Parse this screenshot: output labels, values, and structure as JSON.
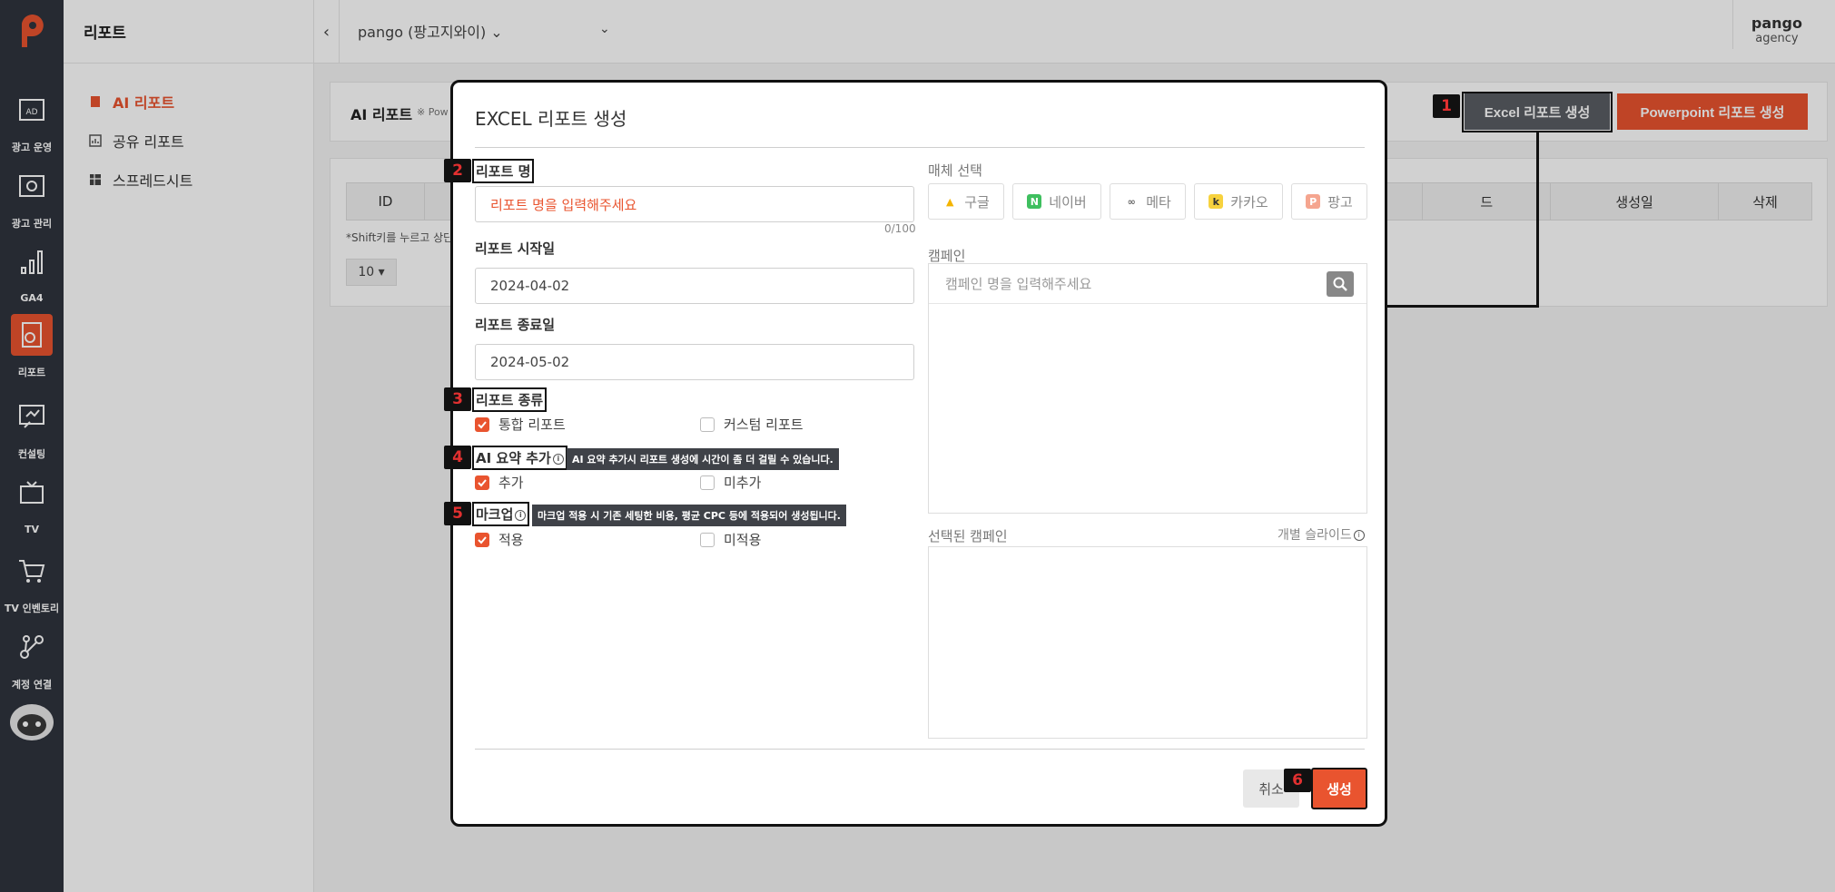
{
  "nav": {
    "items": [
      {
        "label": "광고 운영"
      },
      {
        "label": "광고 관리"
      },
      {
        "label": "GA4"
      },
      {
        "label": "리포트"
      },
      {
        "label": "컨설팅"
      },
      {
        "label": "TV"
      },
      {
        "label": "TV 인벤토리"
      },
      {
        "label": "계정 연결"
      }
    ]
  },
  "sidepanel": {
    "title": "리포트",
    "menu": [
      {
        "label": "AI 리포트"
      },
      {
        "label": "공유 리포트"
      },
      {
        "label": "스프레드시트"
      }
    ]
  },
  "topbar": {
    "account": "pango (팡고지와이) ⌄",
    "user_name": "pango",
    "user_role": "agency"
  },
  "content": {
    "header_title": "AI 리포트",
    "header_note": "※ Pow",
    "excel_button": "Excel 리포트 생성",
    "ppt_button": "Powerpoint 리포트 생성",
    "table_headers": [
      "ID",
      "",
      "드",
      "생성일",
      "삭제"
    ],
    "table_note": "*Shift키를 누르고 상단",
    "page_size": "10 ▾"
  },
  "modal": {
    "title": "EXCEL 리포트 생성",
    "report_name_label": "리포트 명",
    "report_name_placeholder": "리포트 명을 입력해주세요",
    "report_name_counter": "0/100",
    "start_label": "리포트 시작일",
    "start_value": "2024-04-02",
    "end_label": "리포트 종료일",
    "end_value": "2024-05-02",
    "type_label": "리포트 종류",
    "type_options": [
      {
        "label": "통합 리포트",
        "checked": true
      },
      {
        "label": "커스텀 리포트",
        "checked": false
      }
    ],
    "ai_label": "AI 요약 추가",
    "ai_tooltip": "AI 요약 추가시 리포트 생성에 시간이 좀 더 걸릴 수 있습니다.",
    "ai_options": [
      {
        "label": "추가",
        "checked": true
      },
      {
        "label": "미추가",
        "checked": false
      }
    ],
    "markup_label": "마크업",
    "markup_tooltip": "마크업 적용 시 기존 세팅한 비용, 평균 CPC 등에 적용되어 생성됩니다.",
    "markup_options": [
      {
        "label": "적용",
        "checked": true
      },
      {
        "label": "미적용",
        "checked": false
      }
    ],
    "media_label": "매체 선택",
    "media": [
      {
        "label": "구글",
        "badge": "▲",
        "color": "#f4b400"
      },
      {
        "label": "네이버",
        "badge": "N",
        "color": "#3fbf5f"
      },
      {
        "label": "메타",
        "badge": "∞",
        "color": "#888888"
      },
      {
        "label": "카카오",
        "badge": "k",
        "color": "#f7d23e"
      },
      {
        "label": "팡고",
        "badge": "P",
        "color": "#e9542f"
      }
    ],
    "campaign_label": "캠페인",
    "campaign_placeholder": "캠페인 명을 입력해주세요",
    "selected_label": "선택된 캠페인",
    "slide_label": "개별 슬라이드",
    "cancel_button": "취소",
    "create_button": "생성"
  },
  "steps": [
    "1",
    "2",
    "3",
    "4",
    "5",
    "6"
  ],
  "colors": {
    "accent": "#e9542f",
    "sidebar": "#2f343e"
  }
}
